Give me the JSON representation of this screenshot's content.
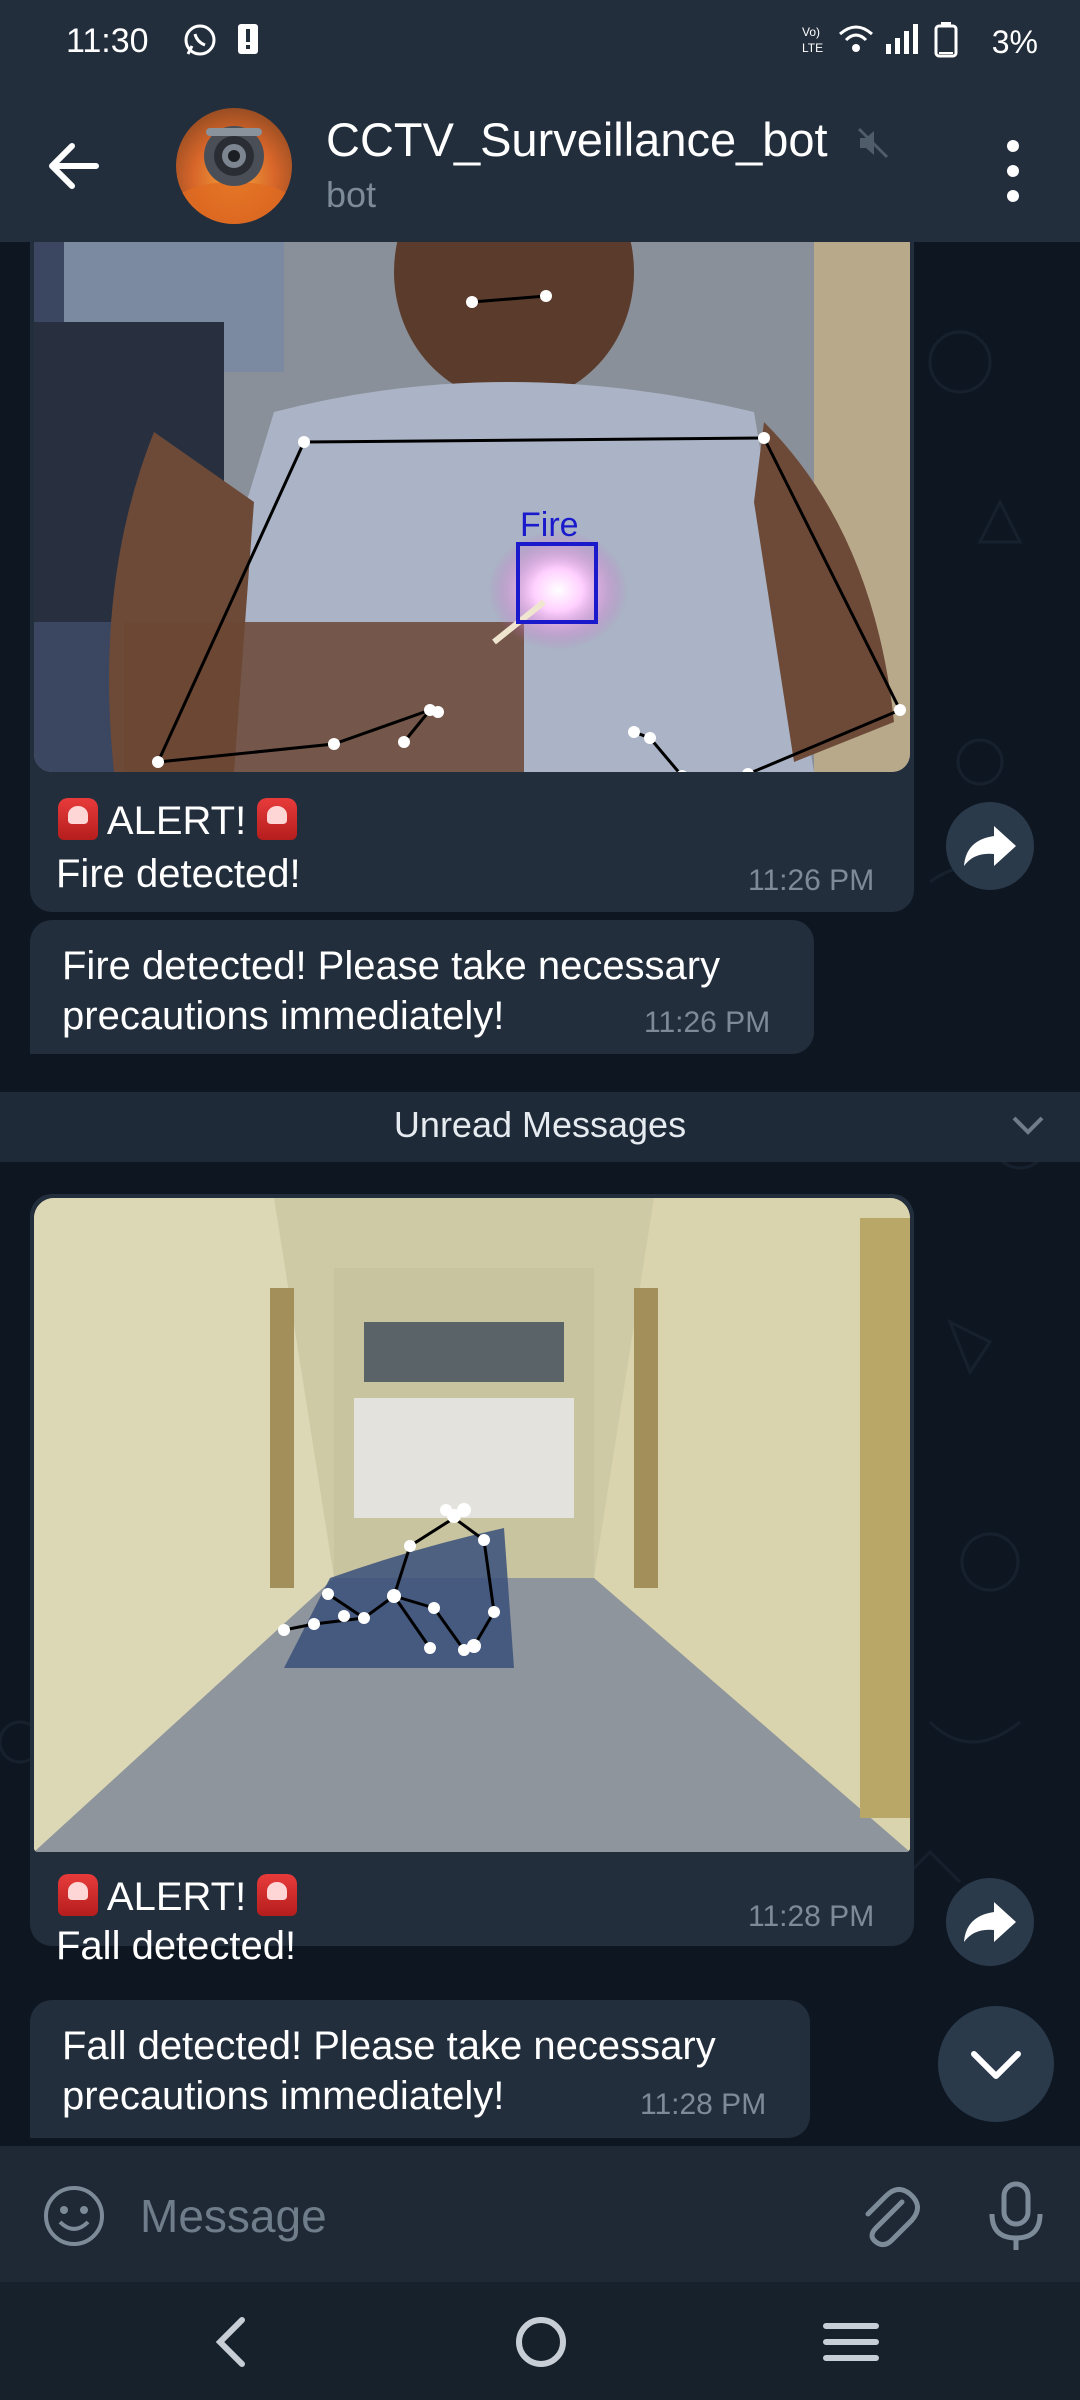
{
  "status_bar": {
    "time": "11:30",
    "battery_percent": "3%",
    "icons": [
      "whatsapp-icon",
      "alert-notification-icon",
      "volte-icon",
      "wifi-icon",
      "signal-icon",
      "battery-icon"
    ]
  },
  "header": {
    "title": "CCTV_Surveillance_bot",
    "subtitle": "bot",
    "muted": true
  },
  "messages": [
    {
      "type": "photo",
      "photo_label": "Fire",
      "caption_line1": "ALERT!",
      "caption_line2": "Fire detected!",
      "time": "11:26 PM"
    },
    {
      "type": "text",
      "line1": "Fire detected! Please take necessary",
      "line2": "precautions immediately!",
      "time": "11:26 PM"
    },
    {
      "type": "photo",
      "caption_line1": "ALERT!",
      "caption_line2": "Fall detected!",
      "time": "11:28 PM"
    },
    {
      "type": "text",
      "line1": "Fall detected! Please take necessary",
      "line2": "precautions immediately!",
      "time": "11:28 PM"
    }
  ],
  "unread_divider": "Unread Messages",
  "composer": {
    "placeholder": "Message"
  },
  "colors": {
    "header_bg": "#232e3c",
    "chat_bg": "#0e1621",
    "bubble_bg": "#232e3c",
    "time_text": "#7d8b99",
    "fire_box": "#1a1acc"
  }
}
